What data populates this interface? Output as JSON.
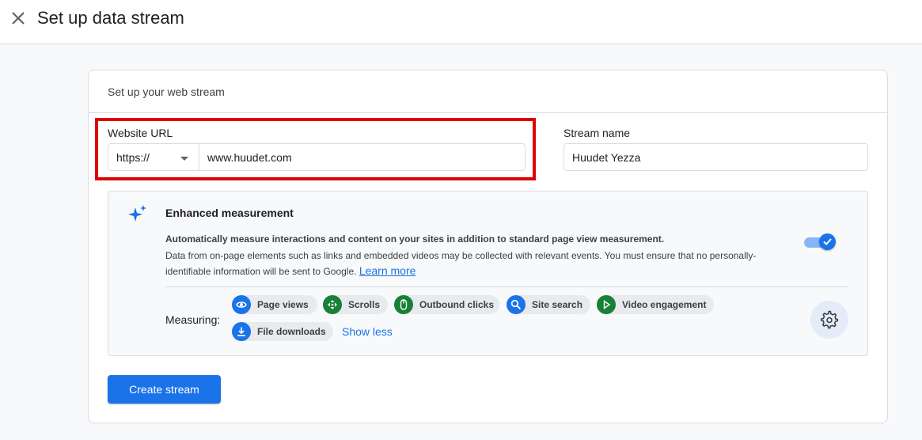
{
  "header": {
    "title": "Set up data stream",
    "close_icon": "close-icon"
  },
  "card": {
    "title": "Set up your web stream"
  },
  "website_url": {
    "label": "Website URL",
    "protocol": "https://",
    "value": "www.huudet.com"
  },
  "stream_name": {
    "label": "Stream name",
    "value": "Huudet Yezza"
  },
  "enhanced": {
    "title": "Enhanced measurement",
    "desc_bold": "Automatically measure interactions and content on your sites in addition to standard page view measurement.",
    "desc": "Data from on-page elements such as links and embedded videos may be collected with relevant events. You must ensure that no personally-identifiable information will be sent to Google.",
    "learn_more": "Learn more",
    "enabled": true,
    "measuring_label": "Measuring:",
    "chips": [
      {
        "label": "Page views",
        "icon": "eye-icon",
        "color": "#1a73e8"
      },
      {
        "label": "Scrolls",
        "icon": "move-icon",
        "color": "#188038"
      },
      {
        "label": "Outbound clicks",
        "icon": "mouse-icon",
        "color": "#188038"
      },
      {
        "label": "Site search",
        "icon": "search-icon",
        "color": "#1a73e8"
      },
      {
        "label": "Video engagement",
        "icon": "play-icon",
        "color": "#188038"
      },
      {
        "label": "File downloads",
        "icon": "download-icon",
        "color": "#1a73e8"
      }
    ],
    "show_less": "Show less"
  },
  "create_button": "Create stream",
  "colors": {
    "accent": "#1a73e8",
    "highlight": "#e00000",
    "green": "#188038"
  }
}
